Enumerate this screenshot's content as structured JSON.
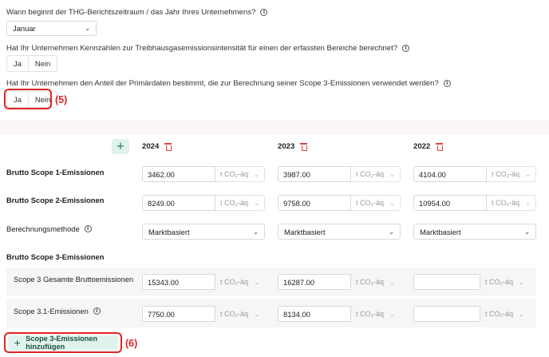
{
  "questions": {
    "q1": {
      "label": "Wann beginnt der THG-Berichtszeitraum / das Jahr Ihres Unternehmens?",
      "value": "Januar"
    },
    "q2": {
      "label": "Hat Ihr Unternehmen Kennzahlen zur Treibhausgasemissionsintensität für einen der erfassten Bereiche berechnet?",
      "yes": "Ja",
      "no": "Nein"
    },
    "q3": {
      "label": "Hat Ihr Unternehmen den Anteil der Primärdaten bestimmt, die zur Berechnung seiner Scope 3-Emissionen verwendet werden?",
      "yes": "Ja",
      "no": "Nein",
      "annotation": "(5)"
    }
  },
  "table": {
    "add_column": "+",
    "years": [
      "2024",
      "2023",
      "2022"
    ],
    "unit": "t CO₂-äq",
    "rows": {
      "scope1": {
        "label": "Brutto Scope 1-Emissionen",
        "values": [
          "3462.00",
          "3987.00",
          "4104.00"
        ]
      },
      "scope2": {
        "label": "Brutto Scope 2-Emissionen",
        "values": [
          "8249.00",
          "9758.00",
          "10954.00"
        ]
      },
      "method": {
        "label": "Berechnungsmethode",
        "values": [
          "Marktbasiert",
          "Marktbasiert",
          "Marktbasiert"
        ]
      },
      "scope3_header": {
        "label": "Brutto Scope 3-Emissionen"
      },
      "scope3_total": {
        "label": "Scope 3 Gesamte Bruttoemissionen",
        "values": [
          "15343.00",
          "16287.00",
          ""
        ]
      },
      "scope3_1": {
        "label": "Scope 3.1-Emissionen",
        "values": [
          "7750.00",
          "8134.00",
          ""
        ]
      }
    },
    "add_scope3_button": {
      "icon": "+",
      "label": "Scope 3-Emissionen hinzufügen",
      "annotation": "(6)"
    }
  },
  "colors": {
    "accent_bg": "#dff3ec",
    "highlight": "#e02424",
    "delete": "#e04040"
  }
}
